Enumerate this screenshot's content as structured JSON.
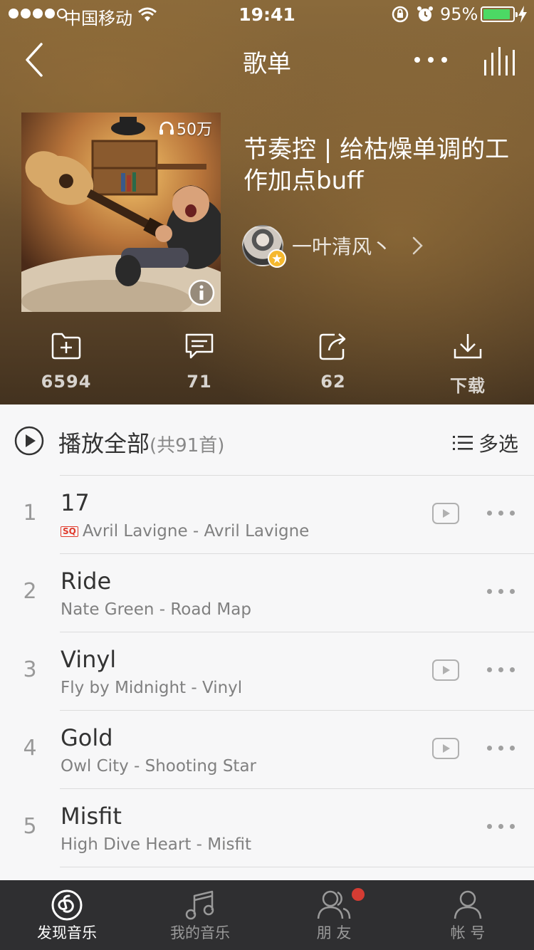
{
  "status_bar": {
    "carrier": "中国移动",
    "time": "19:41",
    "battery": "95%"
  },
  "nav": {
    "title": "歌单"
  },
  "playlist": {
    "play_count": "50万",
    "title": "节奏控 | 给枯燥单调的工作加点buff",
    "creator": "一叶清风丶"
  },
  "actions": {
    "collect": "6594",
    "comment": "71",
    "share": "62",
    "download": "下载"
  },
  "play_all": {
    "label": "播放全部",
    "count": "(共91首)",
    "multi_select": "多选"
  },
  "songs": [
    {
      "index": "1",
      "title": "17",
      "subtitle": "Avril Lavigne - Avril Lavigne",
      "sq": "SQ",
      "mv": true
    },
    {
      "index": "2",
      "title": "Ride",
      "subtitle": "Nate Green - Road Map",
      "sq": "",
      "mv": false
    },
    {
      "index": "3",
      "title": "Vinyl",
      "subtitle": "Fly by Midnight - Vinyl",
      "sq": "",
      "mv": true
    },
    {
      "index": "4",
      "title": "Gold",
      "subtitle": "Owl City - Shooting Star",
      "sq": "",
      "mv": true
    },
    {
      "index": "5",
      "title": "Misfit",
      "subtitle": "High Dive Heart - Misfit",
      "sq": "",
      "mv": false
    }
  ],
  "tabs": [
    {
      "label": "发现音乐",
      "icon": "netease-music-icon",
      "active": true
    },
    {
      "label": "我的音乐",
      "icon": "music-note-icon",
      "active": false
    },
    {
      "label": "朋 友",
      "icon": "friends-icon",
      "active": false,
      "badge": true
    },
    {
      "label": "帐 号",
      "icon": "account-icon",
      "active": false
    }
  ],
  "colors": {
    "header_brown": "#7a5c34",
    "tabbar_bg": "#2f2f31",
    "badge_red": "#d43c33",
    "battery_green": "#4cd964"
  }
}
